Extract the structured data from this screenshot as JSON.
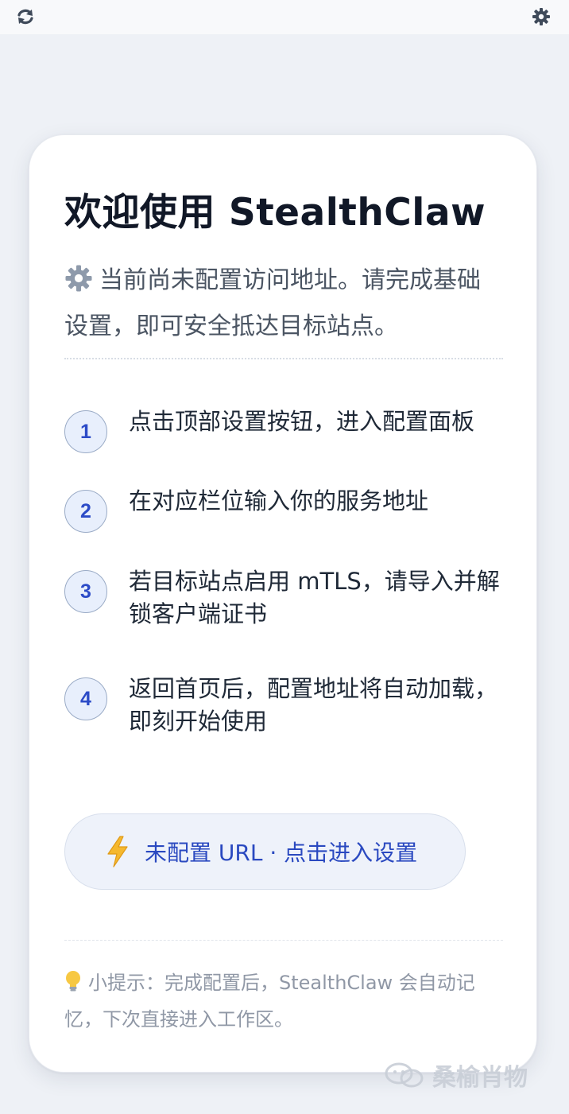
{
  "topbar": {
    "refresh_icon": "refresh-icon",
    "settings_icon": "gear-icon"
  },
  "card": {
    "title": "欢迎使用 StealthClaw",
    "intro_icon": "gear-emoji-icon",
    "intro": "当前尚未配置访问地址。请完成基础设置，即可安全抵达目标站点。",
    "steps": [
      {
        "number": "1",
        "text": "点击顶部设置按钮，进入配置面板"
      },
      {
        "number": "2",
        "text": "在对应栏位输入你的服务地址"
      },
      {
        "number": "3",
        "text": "若目标站点启用 mTLS，请导入并解锁客户端证书"
      },
      {
        "number": "4",
        "text": "返回首页后，配置地址将自动加载，即刻开始使用"
      }
    ],
    "cta": {
      "icon": "lightning-icon",
      "label": "未配置 URL · 点击进入设置"
    },
    "tip": {
      "icon": "lightbulb-icon",
      "text": "小提示：完成配置后，StealthClaw 会自动记忆，下次直接进入工作区。"
    }
  },
  "watermark": {
    "text": "桑榆肖物"
  },
  "colors": {
    "accent": "#2a49c0",
    "background": "#eef1f6",
    "card": "#ffffff"
  }
}
